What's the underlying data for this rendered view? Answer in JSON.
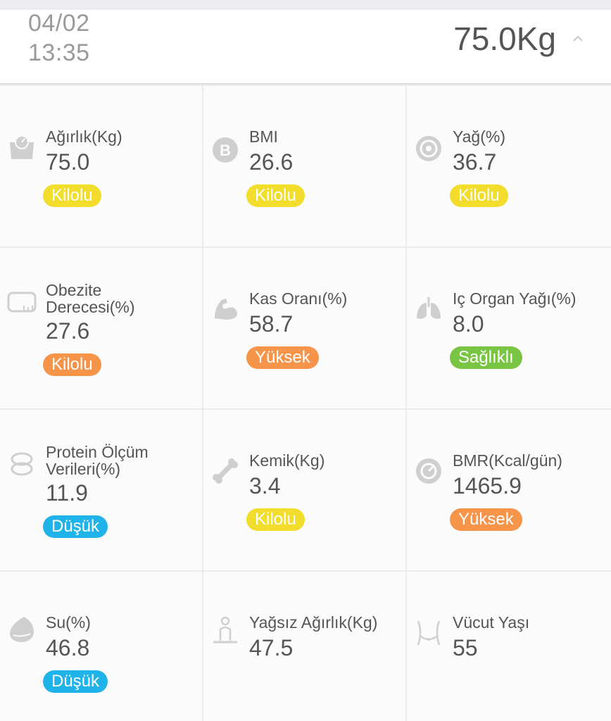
{
  "header": {
    "date": "04/02",
    "time": "13:35",
    "total_weight": "75.0Kg"
  },
  "metrics": [
    {
      "label": "Ağırlık(Kg)",
      "value": "75.0",
      "status": "Kilolu",
      "icon": "scale-icon"
    },
    {
      "label": "BMI",
      "value": "26.6",
      "status": "Kilolu",
      "icon": "bmi-icon"
    },
    {
      "label": "Yağ(%)",
      "value": "36.7",
      "status": "Kilolu",
      "icon": "fat-icon"
    },
    {
      "label": "Obezite Derecesi(%)",
      "value": "27.6",
      "status": "Kilolu",
      "icon": "tape-measure-icon"
    },
    {
      "label": "Kas Oranı(%)",
      "value": "58.7",
      "status": "Yüksek",
      "icon": "muscle-icon"
    },
    {
      "label": "Iç Organ Yağı(%)",
      "value": "8.0",
      "status": "Sağlıklı",
      "icon": "lungs-icon"
    },
    {
      "label": "Protein Ölçüm Verileri(%)",
      "value": "11.9",
      "status": "Düşük",
      "icon": "protein-icon"
    },
    {
      "label": "Kemik(Kg)",
      "value": "3.4",
      "status": "Kilolu",
      "icon": "bone-icon"
    },
    {
      "label": "BMR(Kcal/gün)",
      "value": "1465.9",
      "status": "Yüksek",
      "icon": "bmr-icon"
    },
    {
      "label": "Su(%)",
      "value": "46.8",
      "status": "Düşük",
      "icon": "water-drop-icon"
    },
    {
      "label": "Yağsız Ağırlık(Kg)",
      "value": "47.5",
      "status": "",
      "icon": "lean-body-icon"
    },
    {
      "label": "Vücut Yaşı",
      "value": "55",
      "status": "",
      "icon": "body-age-icon"
    }
  ],
  "colors": {
    "yellow": "#f2dc2c",
    "orange": "#f6944a",
    "green": "#79c443",
    "blue": "#1fb3e9"
  }
}
